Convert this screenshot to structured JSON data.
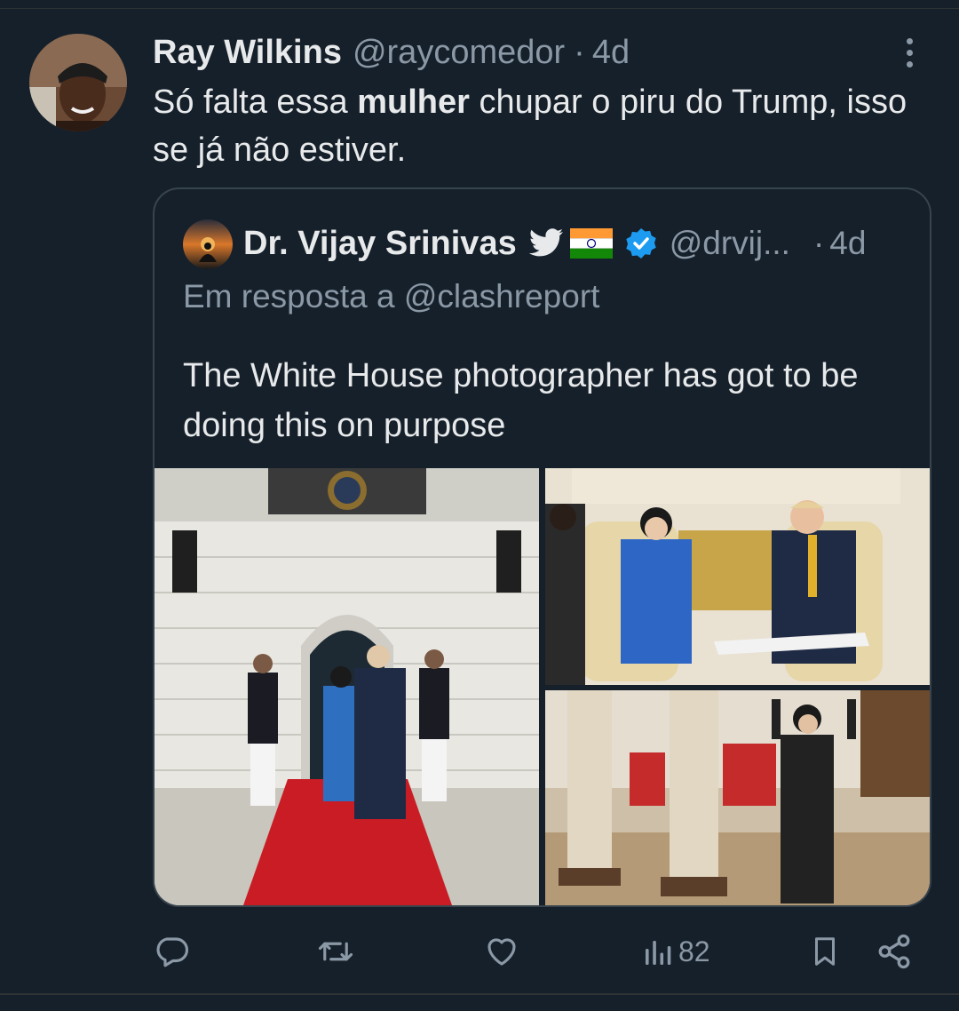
{
  "tweet": {
    "author_name": "Ray Wilkins",
    "author_handle": "@raycomedor",
    "separator": "·",
    "time": "4d",
    "text_before": "Só falta essa ",
    "text_bold": "mulher",
    "text_after": " chupar o piru do Trump, isso se já não estiver."
  },
  "quoted": {
    "author_name": "Dr. Vijay Srinivas",
    "author_handle": "@drvij...",
    "separator": "·",
    "time": "4d",
    "replying_to": "Em resposta a @clashreport",
    "text": "The White House photographer has got to be doing this on purpose",
    "emoji_icons": [
      "twitter-bird-icon",
      "india-flag-icon",
      "verified-badge-icon"
    ]
  },
  "photos": [
    {
      "name": "photo-white-house-entrance"
    },
    {
      "name": "photo-seated-meeting"
    },
    {
      "name": "photo-celebration-room"
    }
  ],
  "actions": {
    "reply_icon": "reply-icon",
    "retweet_icon": "retweet-icon",
    "like_icon": "heart-icon",
    "views_icon": "views-icon",
    "views_count": "82",
    "bookmark_icon": "bookmark-icon",
    "share_icon": "share-icon"
  },
  "colors": {
    "background": "#15202b",
    "text": "#e7e9ea",
    "secondary": "#8b98a5",
    "verified": "#1d9bf0"
  }
}
